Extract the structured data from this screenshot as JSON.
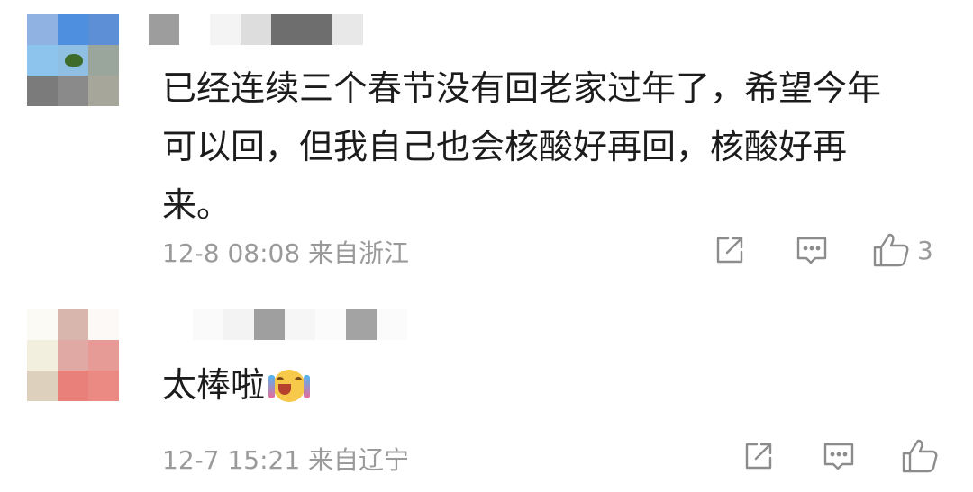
{
  "comments": [
    {
      "text": "已经连续三个春节没有回老家过年了，希望今年\n可以回，但我自己也会核酸好再回，核酸好再\n来。",
      "timestamp": "12-8 08:08",
      "location": "来自浙江",
      "like_count": "3",
      "avatar_icon": "pixelated-avatar-icon",
      "username_icon": "pixelated-username"
    },
    {
      "text": "太棒啦",
      "emoji_icon": "cheering-face-emoji",
      "timestamp": "12-7 15:21",
      "location": "来自辽宁",
      "like_count": "",
      "avatar_icon": "pixelated-avatar-icon",
      "username_icon": "pixelated-username"
    }
  ],
  "icons": {
    "share": "share-icon",
    "reply": "comment-icon",
    "like": "thumbs-up-icon"
  },
  "colors": {
    "text": "#1c1c1c",
    "meta": "#9a9a9a",
    "icon": "#8c8c8c",
    "background": "#ffffff"
  }
}
